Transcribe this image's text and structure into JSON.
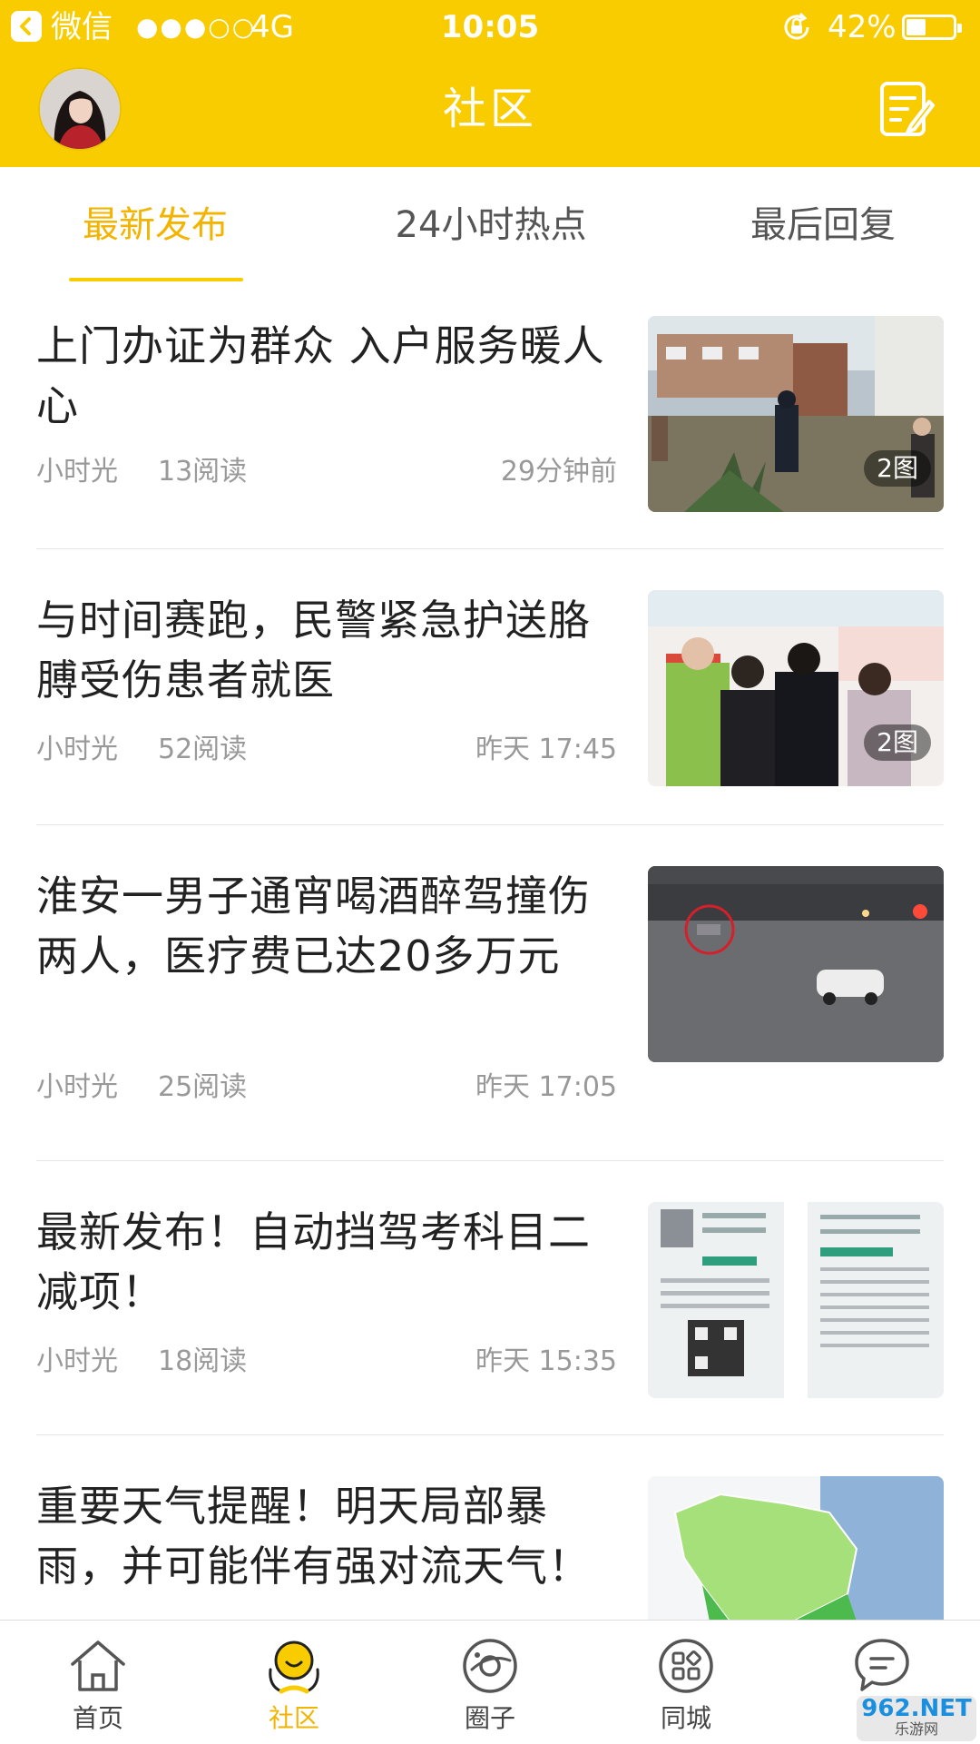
{
  "status_bar": {
    "app_name": "微信",
    "signal": "●●●○○",
    "network": "4G",
    "time": "10:05",
    "battery": "42%",
    "battery_level": 0.42
  },
  "header": {
    "title": "社区",
    "accent_color": "#F9CC00"
  },
  "tabs": [
    {
      "label": "最新发布",
      "active": true
    },
    {
      "label": "24小时热点",
      "active": false
    },
    {
      "label": "最后回复",
      "active": false
    }
  ],
  "posts": [
    {
      "title": "上门办证为群众 入户服务暖人心",
      "author": "小时光",
      "reads": "13阅读",
      "time": "29分钟前",
      "badge": "2图"
    },
    {
      "title": "与时间赛跑，民警紧急护送胳膊受伤患者就医",
      "author": "小时光",
      "reads": "52阅读",
      "time": "昨天 17:45",
      "badge": "2图"
    },
    {
      "title": "淮安一男子通宵喝酒醉驾撞伤两人，医疗费已达20多万元",
      "author": "小时光",
      "reads": "25阅读",
      "time": "昨天 17:05",
      "badge": ""
    },
    {
      "title": "最新发布！自动挡驾考科目二减项！",
      "author": "小时光",
      "reads": "18阅读",
      "time": "昨天 15:35",
      "badge": ""
    },
    {
      "title": "重要天气提醒！明天局部暴雨，并可能伴有强对流天气！",
      "author": "",
      "reads": "",
      "time": "",
      "badge": ""
    }
  ],
  "bottom_nav": [
    {
      "label": "首页",
      "icon": "home-icon",
      "active": false
    },
    {
      "label": "社区",
      "icon": "community-icon",
      "active": true
    },
    {
      "label": "圈子",
      "icon": "circle-icon",
      "active": false
    },
    {
      "label": "同城",
      "icon": "local-grid-icon",
      "active": false
    },
    {
      "label": "消息",
      "icon": "chat-bubble-icon",
      "active": false
    }
  ],
  "watermark": {
    "text": "962.NET",
    "sub": "乐游网"
  }
}
